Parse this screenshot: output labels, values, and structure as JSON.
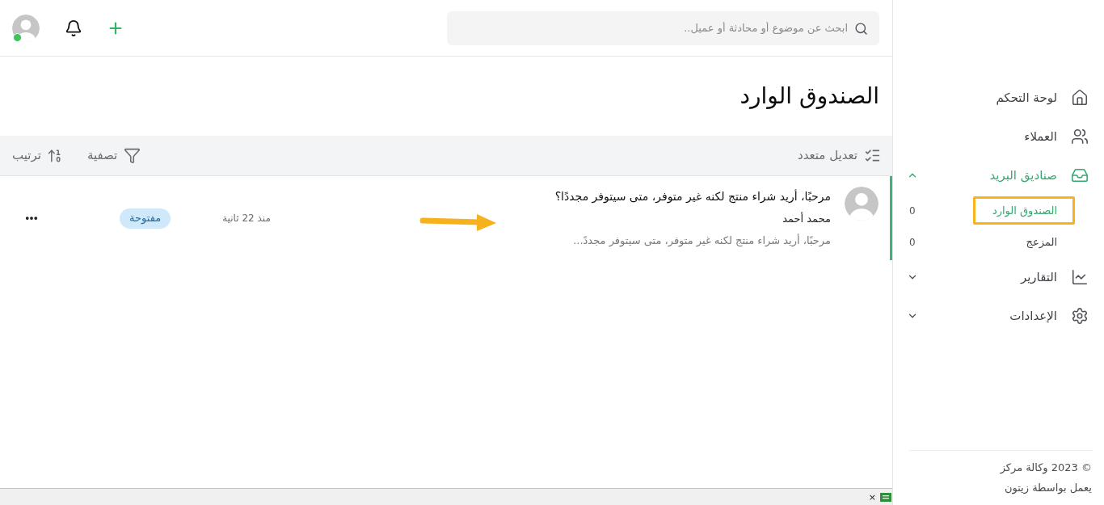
{
  "sidebar": {
    "nav": [
      {
        "kind": "link",
        "label": "لوحة التحكم",
        "selected": false
      },
      {
        "kind": "link",
        "label": "العملاء",
        "selected": false
      },
      {
        "kind": "group",
        "label": "صناديق البريد",
        "selected": true,
        "expanded": true,
        "children": [
          {
            "label": "الصندوق الوارد",
            "count": "0",
            "selected": true,
            "outlined": true
          },
          {
            "label": "المزعج",
            "count": "0",
            "selected": false,
            "outlined": false
          }
        ]
      },
      {
        "kind": "group",
        "label": "التقارير",
        "selected": false,
        "expanded": false
      },
      {
        "kind": "group",
        "label": "الإعدادات",
        "selected": false,
        "expanded": false
      }
    ],
    "footer": {
      "copyright": "© 2023 وكالة مركز",
      "powered_by": "يعمل بواسطة زيتون"
    }
  },
  "top_bar": {
    "search": {
      "placeholder": "ابحث عن موضوع أو محادثة أو عميل.."
    },
    "user": {
      "online": true
    }
  },
  "page": {
    "title": "الصندوق الوارد"
  },
  "toolbar": {
    "bulk_edit": "تعديل متعدد",
    "filter": "تصفية",
    "sort": "ترتيب"
  },
  "conversations": [
    {
      "subject": "مرحبًا، أريد شراء منتج لكنه غير متوفر، متى سيتوفر مجددًا؟",
      "sender": "محمد أحمد",
      "preview": "مرحبًا، أريد شراء منتج لكنه غير متوفر، متى سيتوفر مجددً...",
      "time": "منذ 22 ثانية",
      "status": "مفتوحة",
      "selected": true,
      "marked": true
    }
  ],
  "status_strip": {
    "close": "×"
  }
}
